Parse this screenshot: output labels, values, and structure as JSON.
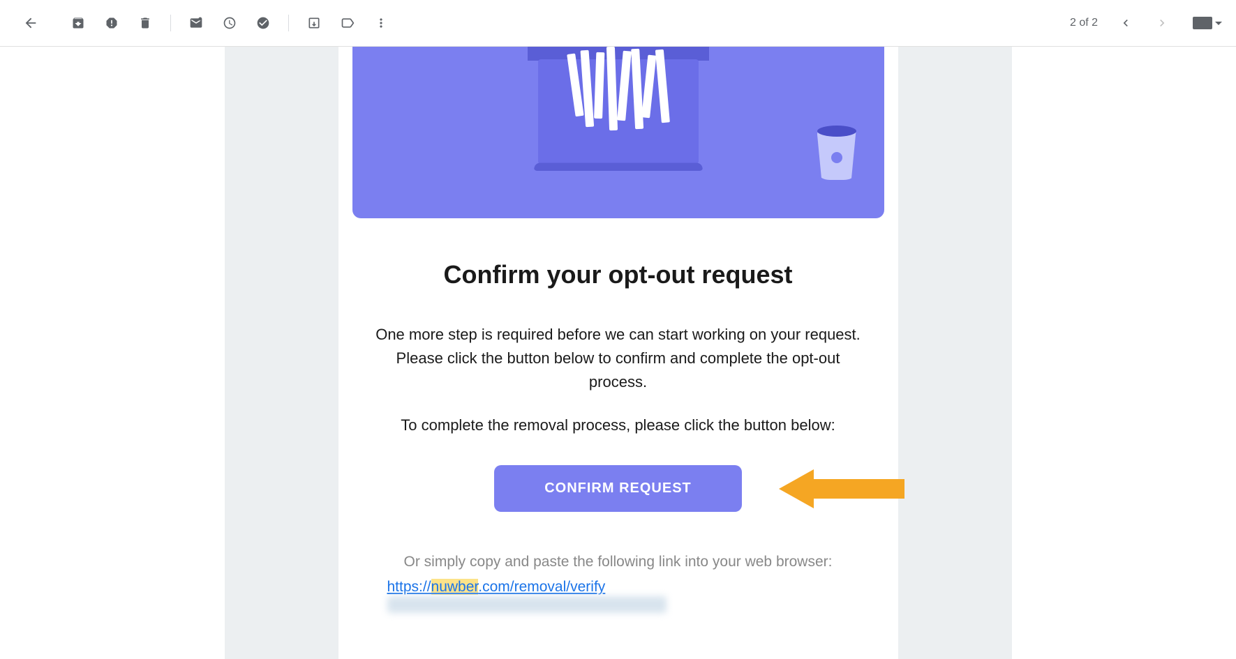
{
  "toolbar": {
    "pager": "2 of 2"
  },
  "email": {
    "heading": "Confirm your opt-out request",
    "para1": "One more step is required before we can start working on your request. Please click the button below to confirm and complete the opt-out process.",
    "para2": "To complete the removal process, please click the button below:",
    "button_label": "CONFIRM REQUEST",
    "alt_text": "Or simply copy and paste the following link into your web browser:",
    "link_prefix": "https://",
    "link_highlight": "nuwber",
    "link_suffix": ".com/removal/verify"
  }
}
